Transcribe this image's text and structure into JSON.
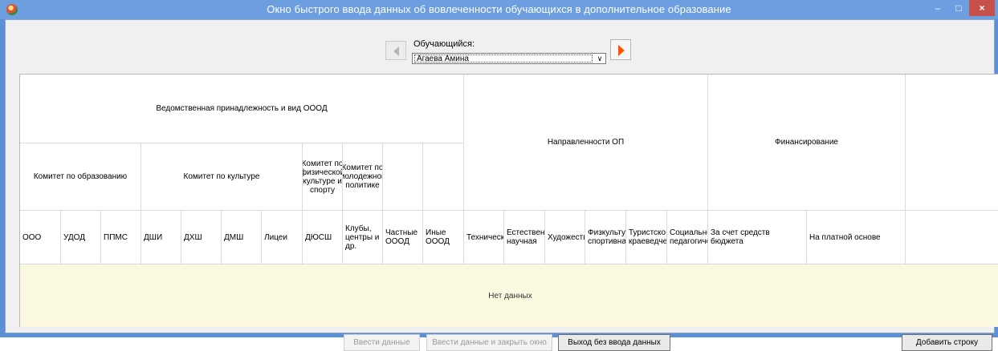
{
  "window": {
    "title": "Окно быстрого ввода данных об вовлеченности обучающихся в дополнительное образование",
    "controls": {
      "minimize": "–",
      "maximize": "□",
      "close": "×"
    }
  },
  "student": {
    "label": "Обучающийся:",
    "selected": "Агаева Амина",
    "dropdown_glyph": "∨"
  },
  "table": {
    "group_dept": "Ведомственная принадлежность и вид ОООД",
    "group_focus": "Направленности ОП",
    "group_fin": "Финансирование",
    "committees": {
      "edu": "Комитет по образованию",
      "culture": "Комитет по культуре",
      "sport": "Комитет по физической культуре и спорту",
      "youth": "Комитет по молодежной политике"
    },
    "columns": [
      "ООО",
      "УДОД",
      "ППМС",
      "ДШИ",
      "ДХШ",
      "ДМШ",
      "Лицеи",
      "ДЮСШ",
      "Клубы, центры и др.",
      "Частные ОООД",
      "Иные ОООД",
      "Техническая",
      "Естественно-научная",
      "Художественная",
      "Физкультурно-спортивная",
      "Туристско-краеведческая",
      "Социально-педагогическая",
      "За счет средств бюджета",
      "На платной основе"
    ],
    "empty_text": "Нет данных"
  },
  "buttons": {
    "enter": "Ввести данные",
    "enter_close": "Ввести данные и закрыть окно",
    "exit": "Выход без ввода данных",
    "add_row": "Добавить строку"
  },
  "colors": {
    "title_bar": "#6c9ee0",
    "close_button": "#c7504a",
    "next_arrow": "#ff5400",
    "empty_area": "#fbf8e0"
  }
}
